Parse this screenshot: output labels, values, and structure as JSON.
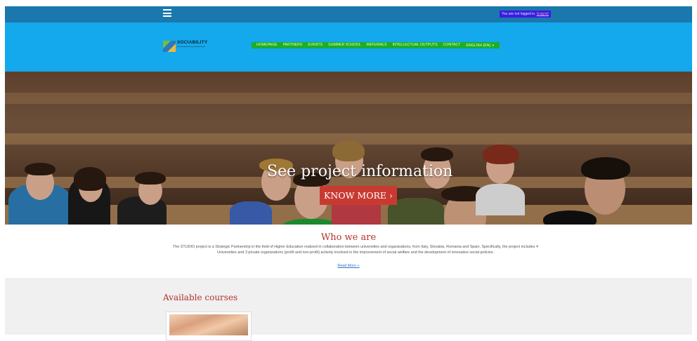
{
  "topbar": {
    "menu_icon": "hamburger-menu-icon",
    "login_text": "You are not logged in.",
    "login_link": "(Log in)"
  },
  "header": {
    "logo_text": "SOCIABILITY",
    "nav": [
      "HOMEPAGE",
      "PARTNERS",
      "EVENTS",
      "SUMMER SCHOOL",
      "MATERIALS",
      "INTELLECTUAL OUTPUTS",
      "CONTACT",
      "ENGLISH (EN)"
    ]
  },
  "hero": {
    "title": "See project information",
    "button": "KNOW MORE ›"
  },
  "who": {
    "title": "Who we are",
    "body": "The STUDIO project is a Strategic Partnership in the field of Higher Education realized in collaboration between universities and organizations, from Italy, Slovakia, Romania and Spain. Specifically, the project includes 4 Universities and 3 private organizations (profit and non-profit) actively involved in the improvement of social welfare and the development of innovative social policies.",
    "read_more": "Read More »"
  },
  "courses": {
    "title": "Available courses"
  },
  "colors": {
    "topbar": "#1a78ac",
    "header": "#14a8ec",
    "nav_bg": "#1cae2a",
    "accent": "#b2322a",
    "button": "#c83a31"
  }
}
